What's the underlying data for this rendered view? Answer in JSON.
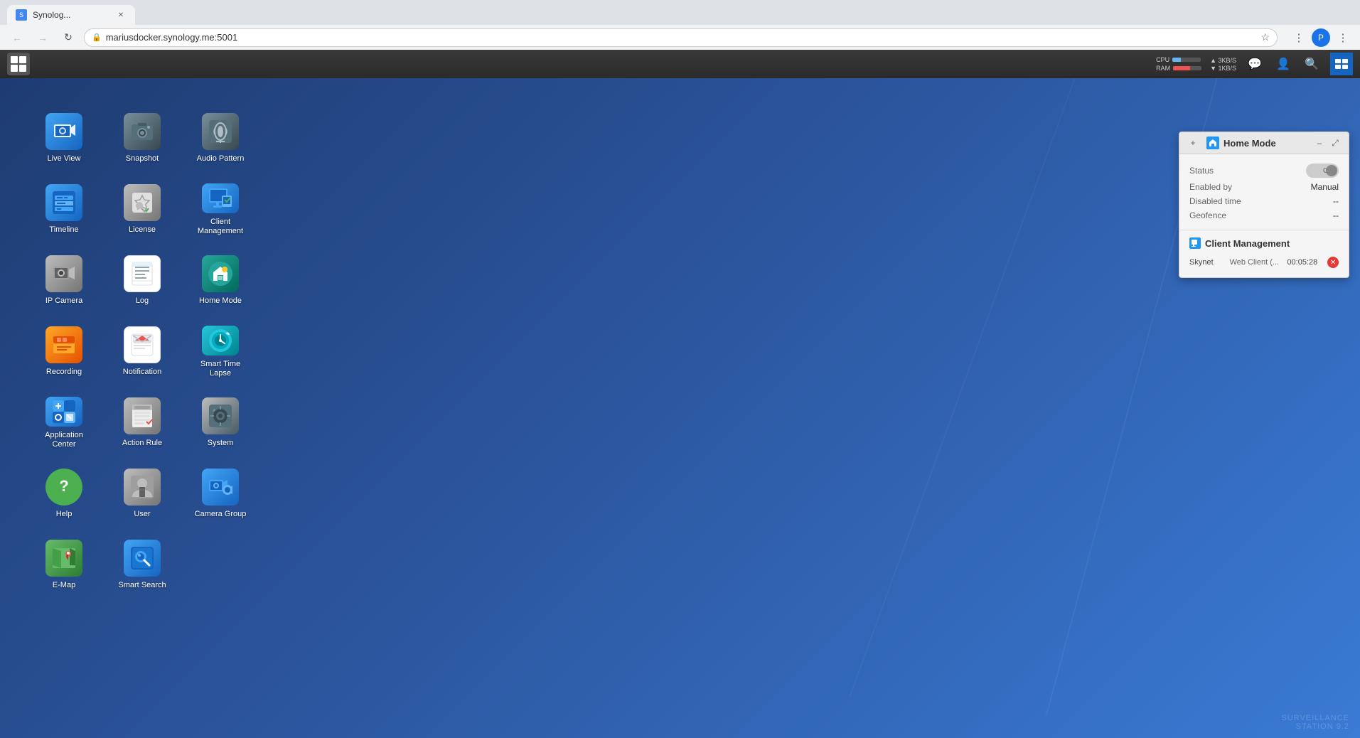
{
  "browser": {
    "tab_title": "Synolog...",
    "address": "mariusdocker.synology.me:5001",
    "favicon": "S"
  },
  "dsm": {
    "cpu_label": "CPU",
    "ram_label": "RAM",
    "cpu_percent": 30,
    "ram_percent": 60,
    "network_up": "3KB/S",
    "network_down": "1KB/S"
  },
  "apps": [
    {
      "id": "live-view",
      "label": "Live View",
      "icon_class": "icon-live-view",
      "icon": "📹"
    },
    {
      "id": "snapshot",
      "label": "Snapshot",
      "icon_class": "icon-snapshot",
      "icon": "📷"
    },
    {
      "id": "audio-pattern",
      "label": "Audio Pattern",
      "icon_class": "icon-audio-pattern",
      "icon": "🎙️"
    },
    {
      "id": "timeline",
      "label": "Timeline",
      "icon_class": "icon-timeline",
      "icon": "📊"
    },
    {
      "id": "license",
      "label": "License",
      "icon_class": "icon-license",
      "icon": "🔑"
    },
    {
      "id": "client-management",
      "label": "Client Management",
      "icon_class": "icon-client-mgmt",
      "icon": "🖥️"
    },
    {
      "id": "ip-camera",
      "label": "IP Camera",
      "icon_class": "icon-ip-camera",
      "icon": "📷"
    },
    {
      "id": "log",
      "label": "Log",
      "icon_class": "icon-log",
      "icon": "📋"
    },
    {
      "id": "home-mode",
      "label": "Home Mode",
      "icon_class": "icon-home-mode",
      "icon": "🏠"
    },
    {
      "id": "recording",
      "label": "Recording",
      "icon_class": "icon-recording",
      "icon": "📁"
    },
    {
      "id": "notification",
      "label": "Notification",
      "icon_class": "icon-notification",
      "icon": "✉️"
    },
    {
      "id": "smart-timelapse",
      "label": "Smart Time Lapse",
      "icon_class": "icon-smart-timelapse",
      "icon": "⏱️"
    },
    {
      "id": "application-center",
      "label": "Application Center",
      "icon_class": "icon-app-center",
      "icon": "🧩"
    },
    {
      "id": "action-rule",
      "label": "Action Rule",
      "icon_class": "icon-action-rule",
      "icon": "📝"
    },
    {
      "id": "system",
      "label": "System",
      "icon_class": "icon-system",
      "icon": "⚙️"
    },
    {
      "id": "help",
      "label": "Help",
      "icon_class": "icon-help",
      "icon": "?"
    },
    {
      "id": "user",
      "label": "User",
      "icon_class": "icon-user",
      "icon": "👤"
    },
    {
      "id": "camera-group",
      "label": "Camera Group",
      "icon_class": "icon-camera-group",
      "icon": "📷"
    },
    {
      "id": "emap",
      "label": "E-Map",
      "icon_class": "icon-emap",
      "icon": "🗺️"
    },
    {
      "id": "smart-search",
      "label": "Smart Search",
      "icon_class": "icon-smart-search",
      "icon": "🔍"
    }
  ],
  "home_mode_widget": {
    "title": "Home Mode",
    "status_label": "Status",
    "status_value": "OFF",
    "enabled_by_label": "Enabled by",
    "enabled_by_value": "Manual",
    "disabled_time_label": "Disabled time",
    "disabled_time_value": "--",
    "geofence_label": "Geofence",
    "geofence_value": "--"
  },
  "client_mgmt_widget": {
    "title": "Client Management",
    "client_name": "Skynet",
    "client_type": "Web Client (...",
    "client_time": "00:05:28"
  },
  "watermark": {
    "line1": "SURVEILLANCE",
    "line2": "STATION 9.2"
  }
}
